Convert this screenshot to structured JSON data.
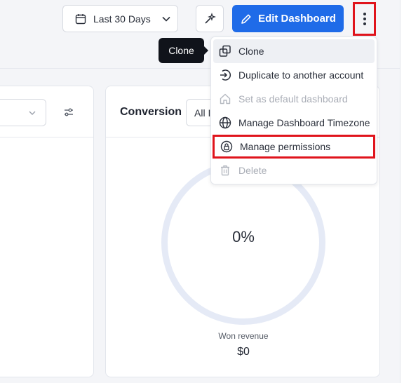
{
  "toolbar": {
    "date_range_label": "Last 30 Days",
    "edit_button_label": "Edit Dashboard"
  },
  "tooltip": {
    "text": "Clone"
  },
  "menu": {
    "items": [
      {
        "label": "Clone",
        "icon": "clone-icon",
        "state": "hover"
      },
      {
        "label": "Duplicate to another account",
        "icon": "duplicate-arrow-icon",
        "state": "enabled"
      },
      {
        "label": "Set as default dashboard",
        "icon": "home-icon",
        "state": "disabled"
      },
      {
        "label": "Manage Dashboard Timezone",
        "icon": "globe-icon",
        "state": "enabled"
      },
      {
        "label": "Manage permissions",
        "icon": "lock-icon",
        "state": "highlighted"
      },
      {
        "label": "Delete",
        "icon": "trash-icon",
        "state": "disabled"
      }
    ]
  },
  "conversion_card": {
    "title": "Conversion",
    "select_value": "All I",
    "ring_value": "0%",
    "won_label": "Won revenue",
    "won_value": "$0"
  },
  "colors": {
    "accent": "#1f6be8",
    "highlight_border": "#e0141c",
    "tooltip_bg": "#10131a",
    "ring": "#e5eaf6"
  }
}
